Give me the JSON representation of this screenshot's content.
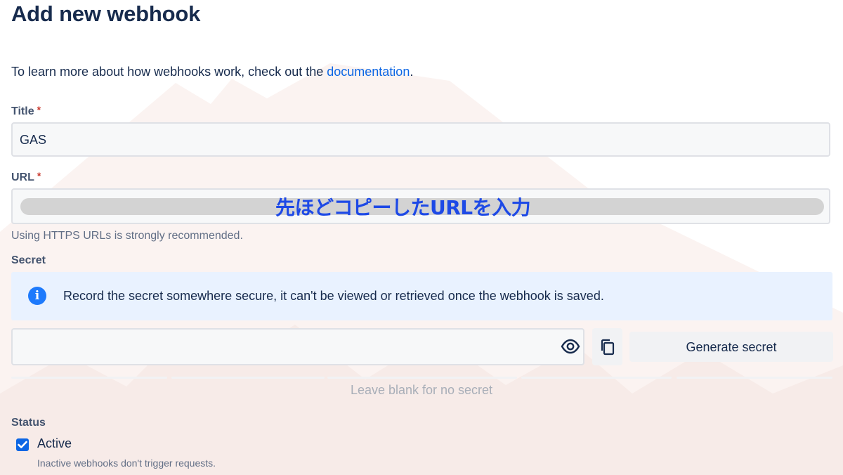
{
  "page": {
    "title": "Add new webhook"
  },
  "intro": {
    "text": "To learn more about how webhooks work, check out the ",
    "link": "documentation",
    "suffix": "."
  },
  "title_field": {
    "label": "Title",
    "required": "*",
    "value": "GAS"
  },
  "url_field": {
    "label": "URL",
    "required": "*",
    "annotation": "先ほどコピーしたURLを入力",
    "help": "Using HTTPS URLs is strongly recommended."
  },
  "secret": {
    "label": "Secret",
    "info": "Record the secret somewhere secure, it can't be viewed or retrieved once the webhook is saved.",
    "value": "",
    "generate_label": "Generate secret",
    "blank_note": "Leave blank for no secret"
  },
  "status": {
    "label": "Status",
    "checkbox_label": "Active",
    "checked": true,
    "help": "Inactive webhooks don't trigger requests."
  },
  "icons": {
    "info": "info-icon",
    "eye": "eye-icon",
    "copy": "copy-icon",
    "check": "check-icon"
  },
  "colors": {
    "link": "#0c66e4",
    "annotation": "#1d49e6",
    "info_bg": "#e9f2ff",
    "checkbox": "#0c66e4"
  }
}
